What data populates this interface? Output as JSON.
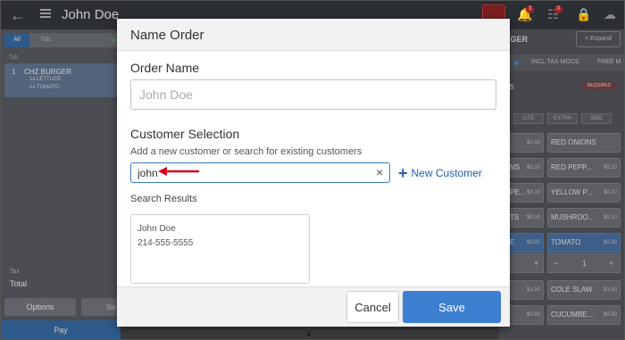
{
  "app": {
    "header_title": "John Doe",
    "badges": [
      "3",
      "0"
    ],
    "order_tabs": {
      "all": "All",
      "tab": "Tab",
      "add": "+"
    },
    "column_header": "Tab",
    "order_line": {
      "qty": "1",
      "item": "CHZ BURGER",
      "mods": [
        "1x LETTUCE",
        "1x TOMATO"
      ]
    },
    "tax_label": "Tax",
    "total_label": "Total",
    "options_label": "Options",
    "second_btn_label": "Se",
    "pay_label": "Pay"
  },
  "right_panel": {
    "title": "RGER",
    "expand_label": "< Expand",
    "tabs": [
      "S",
      "INCL TAX MODS",
      "FREE M"
    ],
    "section": "SS",
    "required_label": "REQUIRED",
    "sizes": [
      "LITE",
      "EXTRA",
      "SIDE"
    ],
    "modifiers": [
      {
        "left": "",
        "left_price": "$0.10",
        "right": "RED ONIONS",
        "right_price": ""
      },
      {
        "left": "NS",
        "left_price": "$0.10",
        "right": "RED PEPP...",
        "right_price": "$0.10"
      },
      {
        "left": "PE...",
        "left_price": "$0.10",
        "right": "YELLOW P...",
        "right_price": "$0.10"
      },
      {
        "left": "TS",
        "left_price": "$0.10",
        "right": "MUSHROO...",
        "right_price": "$0.10"
      },
      {
        "left": "E",
        "left_price": "$0.00",
        "right": "TOMATO",
        "right_price": "$0.00"
      },
      {
        "left": "",
        "left_price": "$1.50",
        "right": "COLE SLAW",
        "right_price": "$1.50"
      },
      {
        "left": "",
        "left_price": "$0.50",
        "right": "CUCUMBE...",
        "right_price": "$0.50"
      }
    ],
    "stepper": {
      "minus": "−",
      "value": "1",
      "plus": "+"
    }
  },
  "modal": {
    "title": "Name Order",
    "order_name_label": "Order Name",
    "order_name_placeholder": "John Doe",
    "customer_label": "Customer Selection",
    "customer_hint": "Add a new customer or search for existing customers",
    "search_value": "john",
    "clear_glyph": "×",
    "new_customer_plus": "+",
    "new_customer_label": "New Customer",
    "results_label": "Search Results",
    "results": [
      {
        "name": "John Doe",
        "phone": "214-555-5555"
      }
    ],
    "cancel_label": "Cancel",
    "save_label": "Save"
  },
  "colors": {
    "accent": "#3d7fd1",
    "link": "#1f5fa8",
    "annotation_arrow": "#d0021b"
  }
}
